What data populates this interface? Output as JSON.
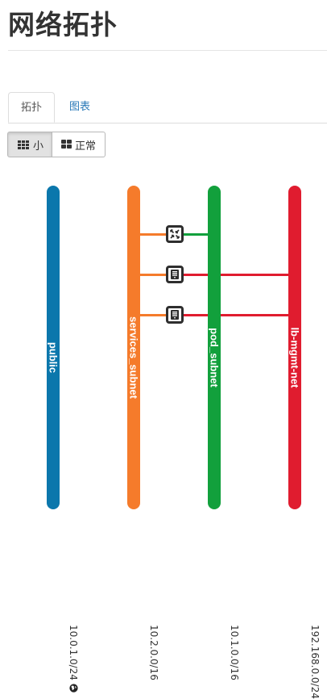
{
  "page": {
    "title": "网络拓扑"
  },
  "tabs": [
    {
      "label": "拓扑",
      "active": true
    },
    {
      "label": "图表",
      "active": false
    }
  ],
  "view_toggle": {
    "small": {
      "label": "小",
      "icon": "grid-small-icon",
      "active": true
    },
    "normal": {
      "label": "正常",
      "icon": "grid-large-icon",
      "active": false
    }
  },
  "networks": [
    {
      "name": "public",
      "cidr": "10.0.1.0/24",
      "color": "#0b77ac",
      "external": true,
      "external_icon": "globe-icon"
    },
    {
      "name": "services_subnet",
      "cidr": "10.2.0.0/16",
      "color": "#f57b2b"
    },
    {
      "name": "pod_subnet",
      "cidr": "10.1.0.0/16",
      "color": "#12a03c"
    },
    {
      "name": "lb-mgmt-net",
      "cidr": "192.168.0.0/24",
      "color": "#e01c2f"
    }
  ],
  "devices": [
    {
      "type": "router",
      "icon": "router-icon"
    },
    {
      "type": "instance",
      "icon": "server-icon"
    },
    {
      "type": "instance",
      "icon": "server-icon"
    }
  ],
  "colors": {
    "tab_link": "#2a7ab8",
    "device_border": "#2e2e2e"
  }
}
